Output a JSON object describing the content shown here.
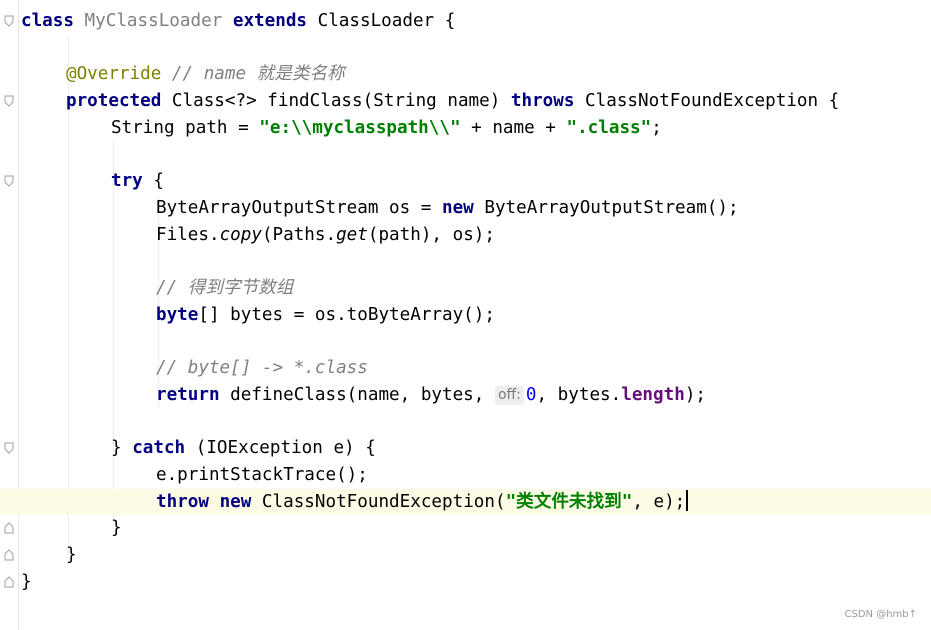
{
  "lines": {
    "l1": {
      "kw_class": "class",
      "name": " MyClassLoader ",
      "kw_extends": "extends",
      "rest": " ClassLoader {"
    },
    "l3": {
      "annotation": "@Override",
      "comment": " // name 就是类名称"
    },
    "l4": {
      "kw_protected": "protected",
      "cls": " Class<?>",
      "mid": " findClass(String name) ",
      "kw_throws": "throws",
      "rest": " ClassNotFoundException {"
    },
    "l5": {
      "pre": "String path = ",
      "str1": "\"e:\\\\myclasspath\\\\\"",
      "mid": " + name + ",
      "str2": "\".class\"",
      "end": ";"
    },
    "l7": {
      "kw_try": "try",
      "rest": " {"
    },
    "l8": {
      "pre": "ByteArrayOutputStream os = ",
      "kw_new": "new",
      "rest": " ByteArrayOutputStream();"
    },
    "l9": {
      "pre": "Files.",
      "copy": "copy",
      "mid": "(Paths.",
      "get": "get",
      "rest": "(path), os);"
    },
    "l11": {
      "comment": "// 得到字节数组"
    },
    "l12": {
      "kw_byte": "byte",
      "rest": "[] bytes = os.toByteArray();"
    },
    "l14": {
      "comment": "// byte[] -> *.class"
    },
    "l15": {
      "kw_return": "return",
      "mid": " defineClass(name, bytes, ",
      "hint": "off:",
      "num": "0",
      "mid2": ", bytes.",
      "field": "length",
      "end": ");"
    },
    "l17": {
      "pre": "} ",
      "kw_catch": "catch",
      "rest": " (IOException e) {"
    },
    "l18": {
      "text": "e.printStackTrace();"
    },
    "l19": {
      "kw_throw": "throw",
      "kw_new": "new",
      "mid": " ClassNotFoundException(",
      "str": "\"类文件未找到\"",
      "end": ", e);"
    },
    "l20": {
      "text": "}"
    },
    "l21": {
      "text": "}"
    },
    "l22": {
      "text": "}"
    }
  },
  "watermark": "CSDN @hmb↑",
  "colors": {
    "keyword": "#000080",
    "string": "#008000",
    "comment": "#808080",
    "annotation": "#808000",
    "field": "#660e7a",
    "number": "#0000ff",
    "current_line": "#fdfbe6"
  }
}
